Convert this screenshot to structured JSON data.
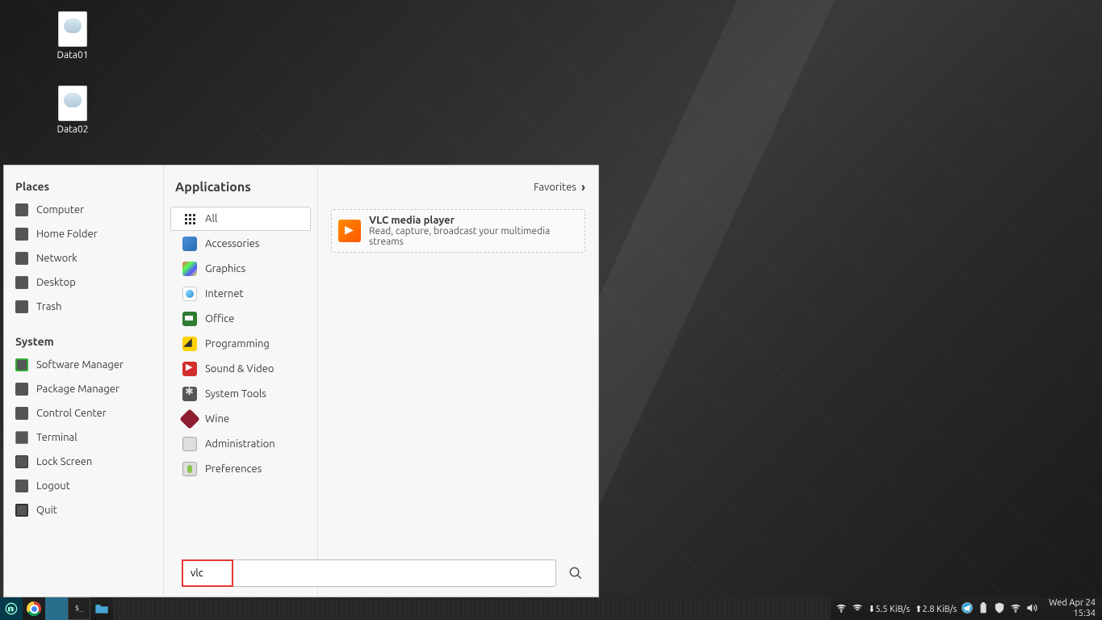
{
  "desktop": {
    "icons": [
      {
        "label": "Data01"
      },
      {
        "label": "Data02"
      }
    ]
  },
  "menu": {
    "left": {
      "places_title": "Places",
      "places": [
        {
          "label": "Computer",
          "icon": "i-computer"
        },
        {
          "label": "Home Folder",
          "icon": "i-home"
        },
        {
          "label": "Network",
          "icon": "i-network"
        },
        {
          "label": "Desktop",
          "icon": "i-desktop"
        },
        {
          "label": "Trash",
          "icon": "i-trash"
        }
      ],
      "system_title": "System",
      "system": [
        {
          "label": "Software Manager",
          "icon": "i-software"
        },
        {
          "label": "Package Manager",
          "icon": "i-package"
        },
        {
          "label": "Control Center",
          "icon": "i-control"
        },
        {
          "label": "Terminal",
          "icon": "i-terminal"
        },
        {
          "label": "Lock Screen",
          "icon": "i-lock"
        },
        {
          "label": "Logout",
          "icon": "i-logout"
        },
        {
          "label": "Quit",
          "icon": "i-quit"
        }
      ]
    },
    "applications_title": "Applications",
    "favorites_label": "Favorites",
    "categories": [
      {
        "label": "All",
        "icon": "c-all",
        "active": true
      },
      {
        "label": "Accessories",
        "icon": "c-acc"
      },
      {
        "label": "Graphics",
        "icon": "c-gfx"
      },
      {
        "label": "Internet",
        "icon": "c-net"
      },
      {
        "label": "Office",
        "icon": "c-off"
      },
      {
        "label": "Programming",
        "icon": "c-prog"
      },
      {
        "label": "Sound & Video",
        "icon": "c-snd"
      },
      {
        "label": "System Tools",
        "icon": "c-sys"
      },
      {
        "label": "Wine",
        "icon": "c-wine"
      },
      {
        "label": "Administration",
        "icon": "c-admin"
      },
      {
        "label": "Preferences",
        "icon": "c-pref"
      }
    ],
    "results": [
      {
        "name": "VLC media player",
        "desc": "Read, capture, broadcast your multimedia streams"
      }
    ],
    "search_value": "vlc"
  },
  "taskbar": {
    "net_down": "5.5 KiB/s",
    "net_up": "2.8 KiB/s",
    "date": "Wed Apr 24",
    "time": "15:34"
  }
}
